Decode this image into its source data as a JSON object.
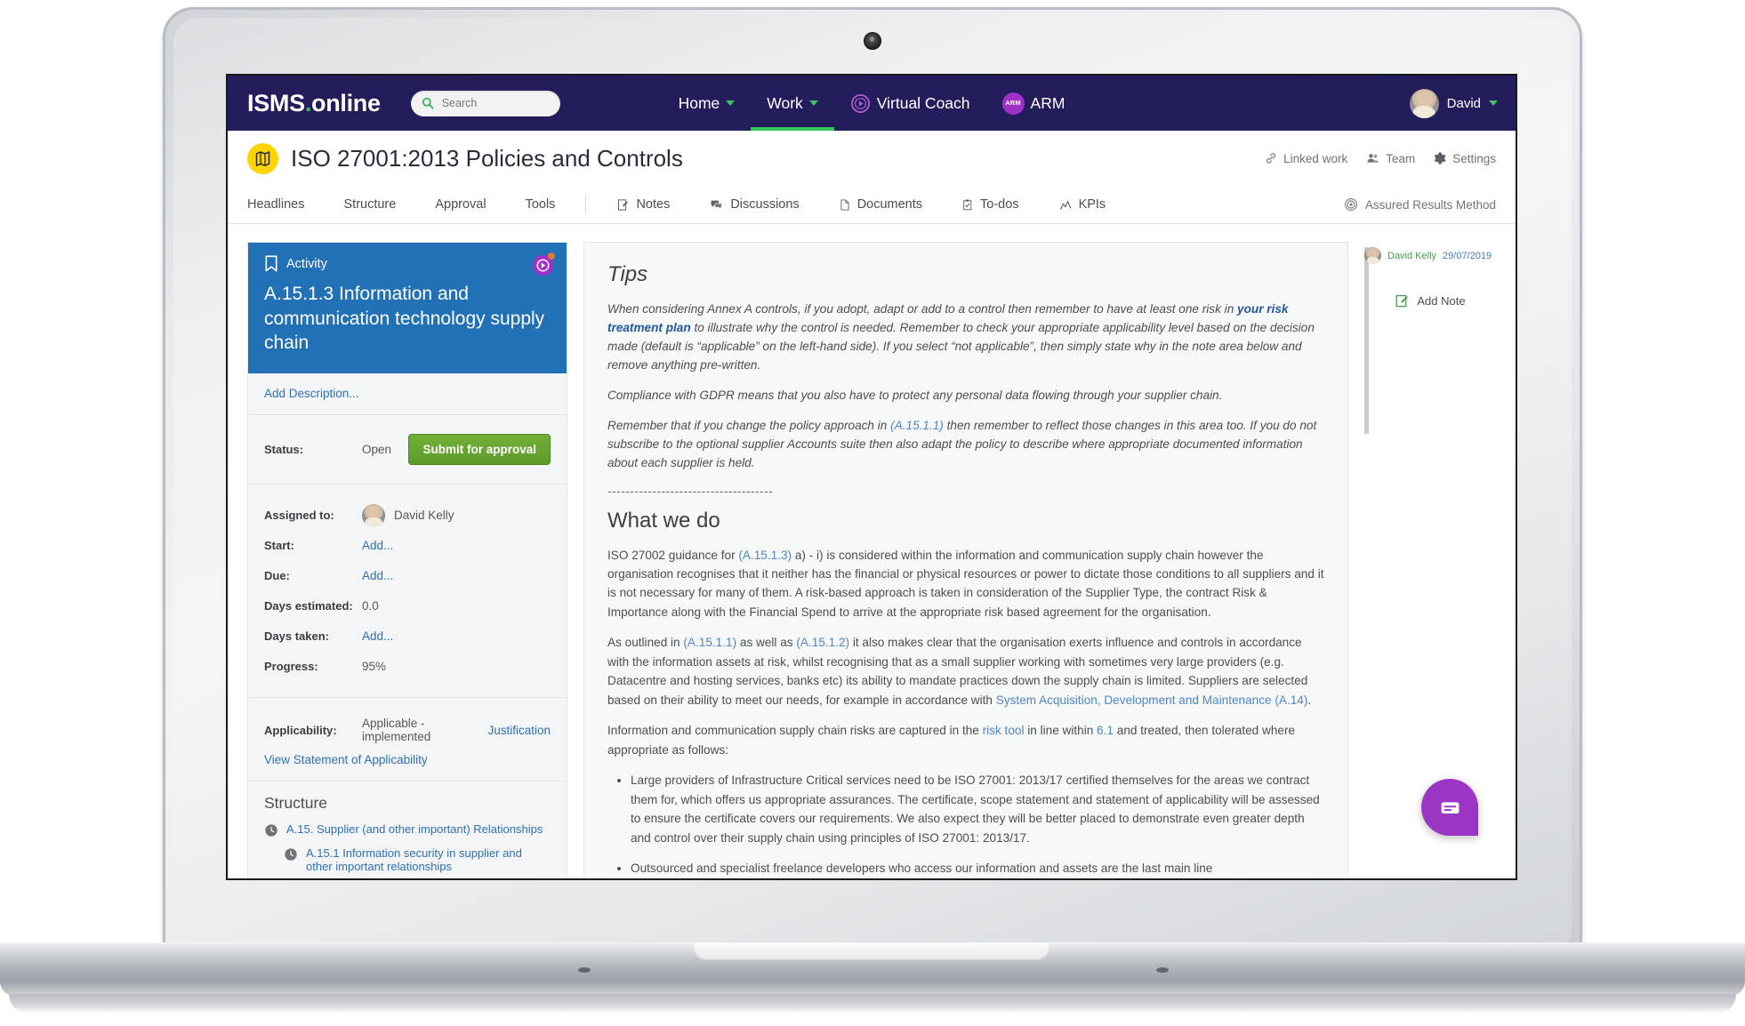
{
  "topnav": {
    "brand_prefix": "ISMS",
    "brand_dot": ".",
    "brand_suffix": "online",
    "search_placeholder": "Search",
    "items": [
      {
        "label": "Home",
        "has_caret": true,
        "active": false
      },
      {
        "label": "Work",
        "has_caret": true,
        "active": true
      },
      {
        "label": "Virtual Coach",
        "has_caret": false,
        "active": false
      },
      {
        "label": "ARM",
        "has_caret": false,
        "active": false
      }
    ],
    "arm_badge": "ARM",
    "user_name": "David",
    "colors": {
      "nav_bg": "#231d5c",
      "accent_green": "#34c759",
      "accent_purple": "#a030c8"
    }
  },
  "pagehead": {
    "title": "ISO 27001:2013 Policies and Controls",
    "tools": [
      {
        "label": "Linked work",
        "icon": "link-icon"
      },
      {
        "label": "Team",
        "icon": "people-icon"
      },
      {
        "label": "Settings",
        "icon": "gear-icon"
      }
    ]
  },
  "tabs": {
    "primary": [
      "Headlines",
      "Structure",
      "Approval",
      "Tools"
    ],
    "secondary": [
      {
        "label": "Notes",
        "icon": "note-icon"
      },
      {
        "label": "Discussions",
        "icon": "discussion-icon"
      },
      {
        "label": "Documents",
        "icon": "document-icon"
      },
      {
        "label": "To-dos",
        "icon": "todo-icon"
      },
      {
        "label": "KPIs",
        "icon": "kpi-icon"
      }
    ],
    "right": {
      "label": "Assured Results Method",
      "icon": "target-icon"
    }
  },
  "activity": {
    "kicker": "Activity",
    "title": "A.15.1.3 Information and communication technology supply chain",
    "add_description": "Add Description...",
    "submit_button": "Submit for approval",
    "fields": [
      {
        "label": "Status:",
        "value": "Open",
        "link": false
      },
      {
        "label": "Assigned to:",
        "value": "David Kelly",
        "link": false
      },
      {
        "label": "Start:",
        "value": "Add...",
        "link": true
      },
      {
        "label": "Due:",
        "value": "Add...",
        "link": true
      },
      {
        "label": "Days estimated:",
        "value": "0.0",
        "link": false
      },
      {
        "label": "Days taken:",
        "value": "Add...",
        "link": true
      },
      {
        "label": "Progress:",
        "value": "95%",
        "link": false
      }
    ],
    "applicability_label": "Applicability:",
    "applicability_value": "Applicable - implemented",
    "applicability_link": "Justification",
    "view_soa": "View Statement of Applicability",
    "structure_title": "Structure",
    "structure_items": [
      {
        "label": "A.15. Supplier (and other important) Relationships",
        "indent": 0
      },
      {
        "label": "A.15.1 Information security in supplier and other important relationships",
        "indent": 1
      }
    ]
  },
  "main": {
    "tips_heading": "Tips",
    "tips_p1_a": "When considering Annex A controls, if you adopt, adapt or add to a control then remember to have at least one risk in ",
    "tips_p1_bold": "your risk treatment plan",
    "tips_p1_b": " to illustrate why the control is needed. Remember to check your appropriate applicability level based on the decision made (default is “applicable” on the left-hand side). If you select “not applicable”, then simply state why in the note area below and remove anything pre-written.",
    "tips_p2": "Compliance with GDPR means that you also have to protect any personal data flowing through your supplier chain.",
    "tips_p3_a": "Remember that if you change the policy approach in ",
    "tips_p3_ref": "(A.15.1.1)",
    "tips_p3_b": " then remember to reflect those changes in this area too. If you do not subscribe to the optional supplier Accounts suite then also adapt the policy to describe where appropriate documented information about each supplier is held.",
    "divider": "-------------------------------------",
    "wwd_heading": "What we do",
    "wwd_p1_a": "ISO 27002 guidance for ",
    "wwd_p1_ref": "(A.15.1.3)",
    "wwd_p1_b": " a) - i) is considered within the information and communication supply chain however the organisation recognises that it neither has the financial or physical resources or power to dictate those conditions to all suppliers and it is not necessary for many of them. A risk-based approach is taken in consideration of the Supplier Type, the contract Risk & Importance along with the Financial Spend to arrive at the appropriate risk based agreement for the organisation.",
    "wwd_p2_a": "As outlined in ",
    "wwd_p2_ref1": "(A.15.1.1)",
    "wwd_p2_b": " as well as ",
    "wwd_p2_ref2": "(A.15.1.2)",
    "wwd_p2_c": " it also makes clear that the organisation exerts influence and controls in accordance with the information assets at risk, whilst recognising that as a small supplier working with sometimes very large providers (e.g. Datacentre and hosting services, banks etc) its ability to mandate practices down the supply chain is limited. Suppliers are selected based on their ability to meet our needs, for example in accordance with ",
    "wwd_p2_ref3": "System Acquisition, Development and Maintenance (A.14)",
    "wwd_p2_d": ".",
    "wwd_p3_a": "Information and communication supply chain risks are captured in the ",
    "wwd_p3_ref1": "risk tool",
    "wwd_p3_b": " in line within ",
    "wwd_p3_ref2": "6.1",
    "wwd_p3_c": " and treated, then tolerated where appropriate as follows:",
    "bullets": [
      "Large providers of Infrastructure Critical services need to be ISO 27001: 2013/17 certified themselves for the areas we contract them for, which offers us appropriate assurances. The certificate, scope statement and statement of applicability will be assessed to ensure the certificate covers our requirements. We also expect they will be better placed to demonstrate even greater depth and control over their supply chain using principles of ISO 27001: 2013/17.",
      "Outsourced and specialist freelance developers who access our information and assets are the last main line"
    ]
  },
  "notes": {
    "author": "David Kelly",
    "date": "29/07/2019",
    "add_note": "Add Note"
  },
  "chat": {
    "icon": "chat-icon"
  }
}
